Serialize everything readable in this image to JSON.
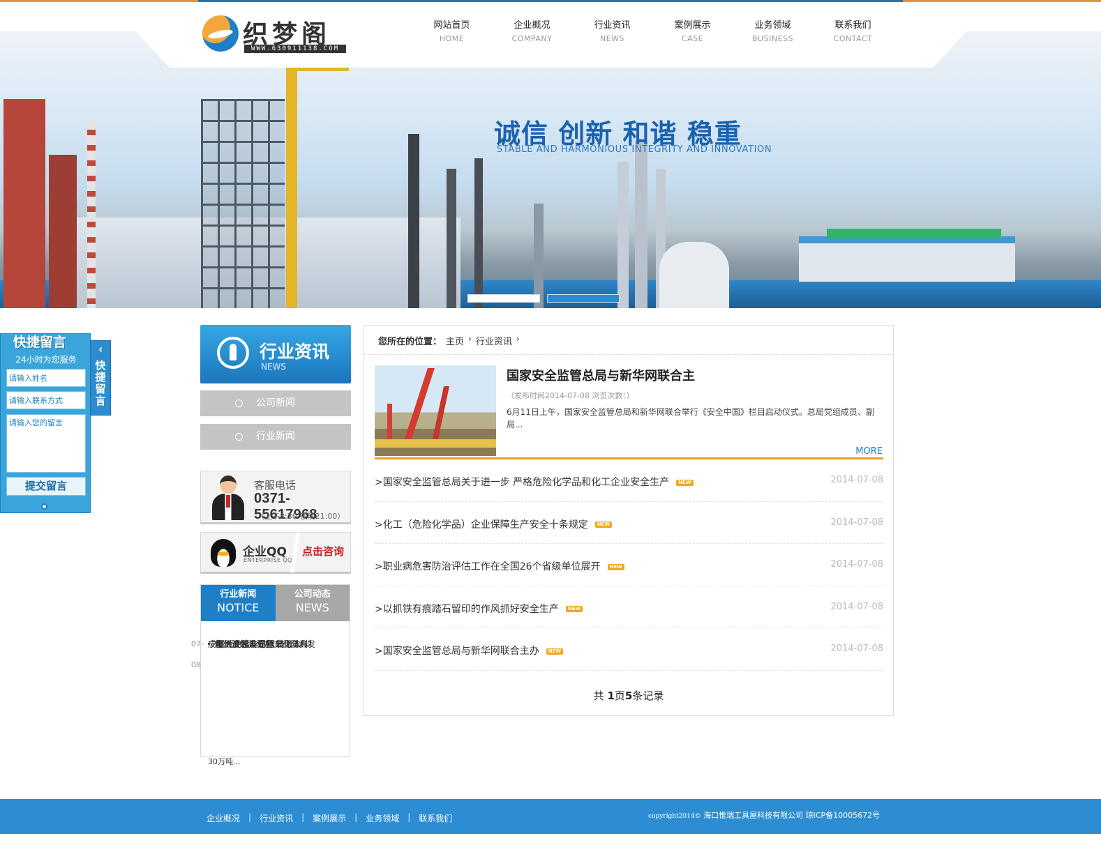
{
  "brand": {
    "logo_text": "织梦阁",
    "logo_url": "WWW.630911138.COM"
  },
  "nav": [
    {
      "cn": "网站首页",
      "en": "HOME"
    },
    {
      "cn": "企业概况",
      "en": "COMPANY"
    },
    {
      "cn": "行业资讯",
      "en": "NEWS"
    },
    {
      "cn": "案例展示",
      "en": "CASE"
    },
    {
      "cn": "业务领域",
      "en": "BUSINESS"
    },
    {
      "cn": "联系我们",
      "en": "CONTACT"
    }
  ],
  "banner": {
    "slogan": "诚信 创新 和谐 稳重",
    "slogan_en": "STABLE AND HARMONIOUS INTEGRITY AND INNOVATION",
    "slides_active": 2
  },
  "quick_message": {
    "title": "快捷留言",
    "subtitle": "24小时为您服务",
    "name_placeholder": "请输入姓名",
    "contact_placeholder": "请输入联系方式",
    "message_placeholder": "请输入您的留言",
    "submit_label": "提交留言",
    "tab_label": "快捷留言"
  },
  "sidebar": {
    "title_cn": "行业资讯",
    "title_en": "NEWS",
    "categories": [
      "公司新闻",
      "行业新闻"
    ],
    "service": {
      "label": "客服电话",
      "phone": "0371-55617968",
      "hours": "（上午8:30-夜晚21:00）"
    },
    "qq": {
      "title": "企业QQ",
      "subtitle": "ENTERPRISE QQ",
      "cta": "点击咨询"
    },
    "news_tabs": [
      {
        "cn": "行业新闻",
        "en": "NOTICE"
      },
      {
        "cn": "公司动态",
        "en": "NEWS"
      }
    ],
    "news_items": [
      {
        "title": "电气设计工程师 若干人...",
        "date": "07-08"
      },
      {
        "title": "化工工艺设计师 若干人...",
        "date": "07-08"
      },
      {
        "title": "郴州汝城县三星工业园鸡发",
        "date": "07-08"
      },
      {
        "title": "成都西中科华昂精细化工科技",
        "date": "07-08"
      },
      {
        "title": "宁夏天元锰业有限公司年产",
        "date": "07-08"
      }
    ],
    "news_overflow": "30万吨..."
  },
  "main": {
    "breadcrumb_label": "您所在的位置：",
    "breadcrumb": [
      "主页",
      "行业资讯"
    ],
    "featured": {
      "title": "国家安全监管总局与新华网联合主",
      "meta": "（发布时间2014-07-08  浏览次数：）",
      "desc": "6月11日上午，国家安全监管总局和新华网联合举行《安全中国》栏目启动仪式。总局党组成员、副局...",
      "more": "MORE"
    },
    "new_badge": "NEW",
    "articles": [
      {
        "title": ">国家安全监管总局关于进一步 严格危险化学品和化工企业安全生产",
        "date": "2014-07-08"
      },
      {
        "title": ">化工（危险化学品）企业保障生产安全十条规定",
        "date": "2014-07-08"
      },
      {
        "title": ">职业病危害防治评估工作在全国26个省级单位展开",
        "date": "2014-07-08"
      },
      {
        "title": ">以抓铁有痕踏石留印的作风抓好安全生产",
        "date": "2014-07-08"
      },
      {
        "title": ">国家安全监管总局与新华网联合主办",
        "date": "2014-07-08"
      }
    ],
    "pager": {
      "prefix": "共 ",
      "pages": "1",
      "mid": "页",
      "records": "5",
      "suffix": "条记录"
    }
  },
  "footer": {
    "links": [
      "企业概况",
      "行业资讯",
      "案例展示",
      "业务领域",
      "联系我们"
    ],
    "copyright_en": "copyright2014©",
    "copyright_cn": "海口惟瑞工具屋科技有限公司 琼ICP备10005672号"
  },
  "colors": {
    "brand_blue": "#2d8dd2",
    "accent_orange": "#f29b1f",
    "side_gray": "#c4c4c4"
  }
}
